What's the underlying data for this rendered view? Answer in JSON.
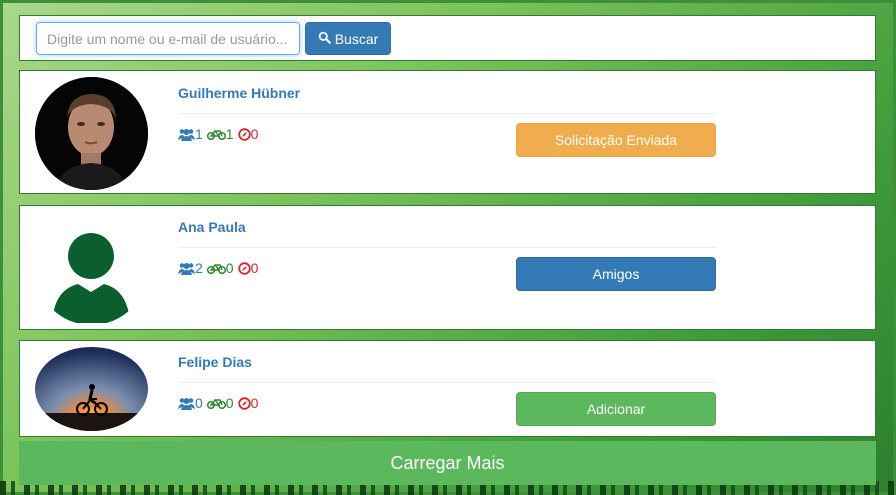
{
  "search": {
    "placeholder": "Digite um nome ou e-mail de usuário...",
    "button_label": "Buscar",
    "button_icon": "search-icon"
  },
  "users": [
    {
      "name": "Guilherme Hübner",
      "avatar": "photo-man-portrait",
      "friends": "1",
      "rides": "1",
      "routes": "0",
      "action_label": "Solicitação Enviada",
      "action_style": "warning"
    },
    {
      "name": "Ana Paula",
      "avatar": "default-user-silhouette",
      "friends": "2",
      "rides": "0",
      "routes": "0",
      "action_label": "Amigos",
      "action_style": "primary"
    },
    {
      "name": "Felipe Dias",
      "avatar": "photo-cyclist-sunset",
      "friends": "0",
      "rides": "0",
      "routes": "0",
      "action_label": "Adicionar",
      "action_style": "success"
    }
  ],
  "load_more_label": "Carregar Mais",
  "colors": {
    "name_link": "#337ab7",
    "friends_icon": "#337ab7",
    "bike_icon": "#2b8a2b",
    "compass_icon": "#d9262e",
    "warning": "#f0ad4e",
    "primary": "#337ab7",
    "success": "#5cb85c",
    "silhouette": "#0b5e2e"
  }
}
